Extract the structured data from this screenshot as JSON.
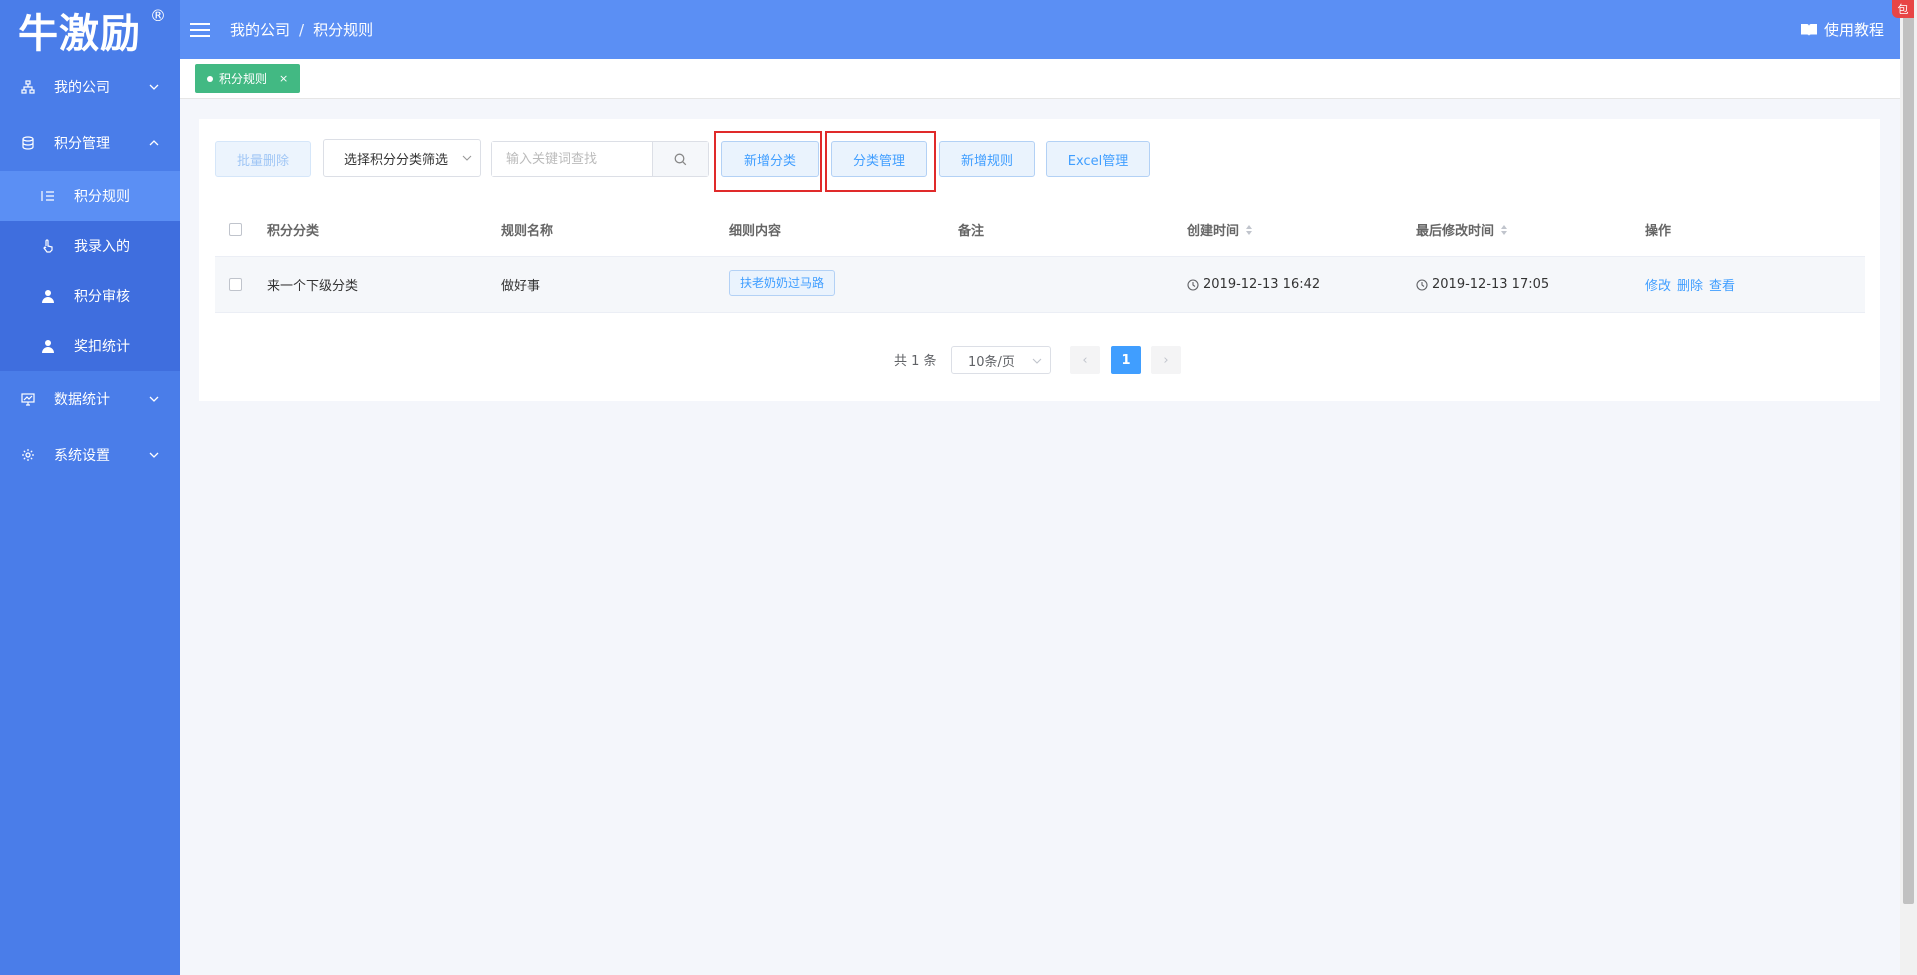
{
  "brand": {
    "logo": "牛激励",
    "reg_mark": "®"
  },
  "sidebar": {
    "items": [
      {
        "label": "我的公司",
        "icon": "org-chart-icon",
        "expanded": false
      },
      {
        "label": "积分管理",
        "icon": "database-icon",
        "expanded": true,
        "children": [
          {
            "label": "积分规则",
            "icon": "list-icon",
            "active": true
          },
          {
            "label": "我录入的",
            "icon": "hand-pointer-icon"
          },
          {
            "label": "积分审核",
            "icon": "user-icon"
          },
          {
            "label": "奖扣统计",
            "icon": "user-icon"
          }
        ]
      },
      {
        "label": "数据统计",
        "icon": "monitor-chart-icon",
        "expanded": false
      },
      {
        "label": "系统设置",
        "icon": "gear-icon",
        "expanded": false
      }
    ]
  },
  "header": {
    "breadcrumb": [
      "我的公司",
      "积分规则"
    ],
    "breadcrumb_sep": "/",
    "tutorial": "使用教程"
  },
  "tabs": [
    {
      "label": "积分规则",
      "close": "×"
    }
  ],
  "toolbar": {
    "batch_delete": "批量删除",
    "category_filter": "选择积分分类筛选",
    "search_placeholder": "输入关键词查找",
    "add_category": "新增分类",
    "category_manage": "分类管理",
    "add_rule": "新增规则",
    "excel_manage": "Excel管理"
  },
  "table": {
    "columns": [
      "积分分类",
      "规则名称",
      "细则内容",
      "备注",
      "创建时间",
      "最后修改时间",
      "操作"
    ],
    "rows": [
      {
        "category": "来一个下级分类",
        "name": "做好事",
        "detail": "扶老奶奶过马路",
        "remark": "",
        "created": "2019-12-13 16:42",
        "modified": "2019-12-13 17:05",
        "actions": [
          "修改",
          "删除",
          "查看"
        ]
      }
    ]
  },
  "pagination": {
    "total": "共 1 条",
    "page_size": "10条/页",
    "current": "1",
    "prev": "‹",
    "next": "›"
  },
  "corner_badge": "包",
  "colors": {
    "sidebar": "#4a7de9",
    "header": "#5b8ff4",
    "tag": "#42b983",
    "primary": "#409eff",
    "highlight": "#e02a2a"
  }
}
